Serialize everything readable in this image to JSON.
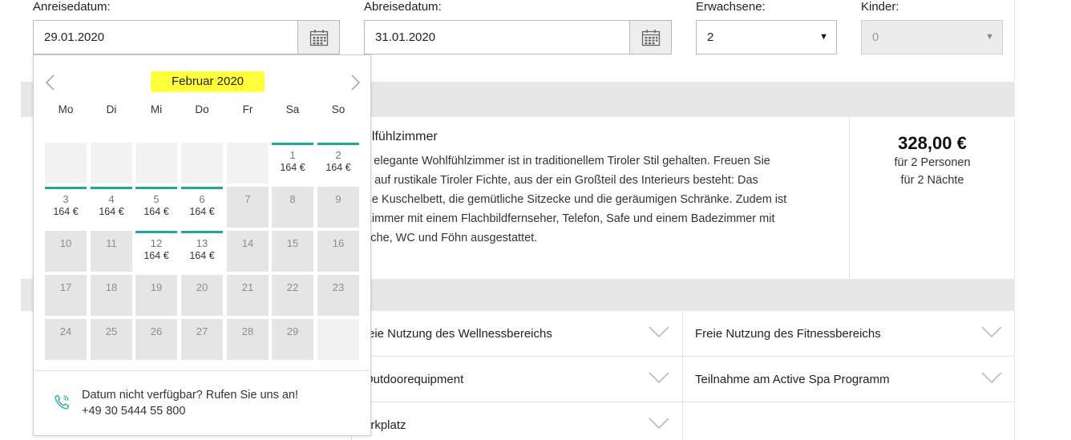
{
  "form": {
    "arrival_label": "Anreisedatum:",
    "arrival_value": "29.01.2020",
    "departure_label": "Abreisedatum:",
    "departure_value": "31.01.2020",
    "adults_label": "Erwachsene:",
    "adults_value": "2",
    "children_label": "Kinder:",
    "children_value": "0"
  },
  "room": {
    "title": "hlfühlzimmer",
    "description": [
      "s elegante Wohlfühlzimmer ist in traditionellem Tiroler Stil gehalten. Freuen Sie",
      "n auf rustikale Tiroler Fichte, aus der ein Großteil des Interieurs besteht: Das",
      "ße Kuschelbett, die gemütliche Sitzecke und die geräumigen Schränke. Zudem ist",
      " Zimmer mit einem Flachbildfernseher, Telefon, Safe und einem Badezimmer mit",
      "sche, WC und Föhn ausgestattet."
    ],
    "price": "328,00 €",
    "price_persons": "für 2 Personen",
    "price_nights": "für 2 Nächte"
  },
  "amenities": [
    "reie Nutzung des Wellnessbereichs",
    "Freie Nutzung des Fitnessbereichs",
    "Outdoorequipment",
    "Teilnahme am Active Spa Programm",
    "arkplatz"
  ],
  "datepicker": {
    "month_title": "Februar 2020",
    "highlight_color": "#ffff3a",
    "available_color": "#1fa89a",
    "weekdays": [
      "Mo",
      "Di",
      "Mi",
      "Do",
      "Fr",
      "Sa",
      "So"
    ],
    "weeks": [
      [
        null,
        null,
        null,
        null,
        null,
        {
          "day": "1",
          "price": "164 €"
        },
        {
          "day": "2",
          "price": "164 €"
        }
      ],
      [
        {
          "day": "3",
          "price": "164 €"
        },
        {
          "day": "4",
          "price": "164 €"
        },
        {
          "day": "5",
          "price": "164 €"
        },
        {
          "day": "6",
          "price": "164 €"
        },
        {
          "day": "7"
        },
        {
          "day": "8"
        },
        {
          "day": "9"
        }
      ],
      [
        {
          "day": "10"
        },
        {
          "day": "11"
        },
        {
          "day": "12",
          "price": "164 €"
        },
        {
          "day": "13",
          "price": "164 €"
        },
        {
          "day": "14"
        },
        {
          "day": "15"
        },
        {
          "day": "16"
        }
      ],
      [
        {
          "day": "17"
        },
        {
          "day": "18"
        },
        {
          "day": "19"
        },
        {
          "day": "20"
        },
        {
          "day": "21"
        },
        {
          "day": "22"
        },
        {
          "day": "23"
        }
      ],
      [
        {
          "day": "24"
        },
        {
          "day": "25"
        },
        {
          "day": "26"
        },
        {
          "day": "27"
        },
        {
          "day": "28"
        },
        {
          "day": "29"
        },
        null
      ]
    ],
    "footer_line1": "Datum nicht verfügbar? Rufen Sie uns an!",
    "footer_line2": "+49 30 5444 55 800"
  }
}
